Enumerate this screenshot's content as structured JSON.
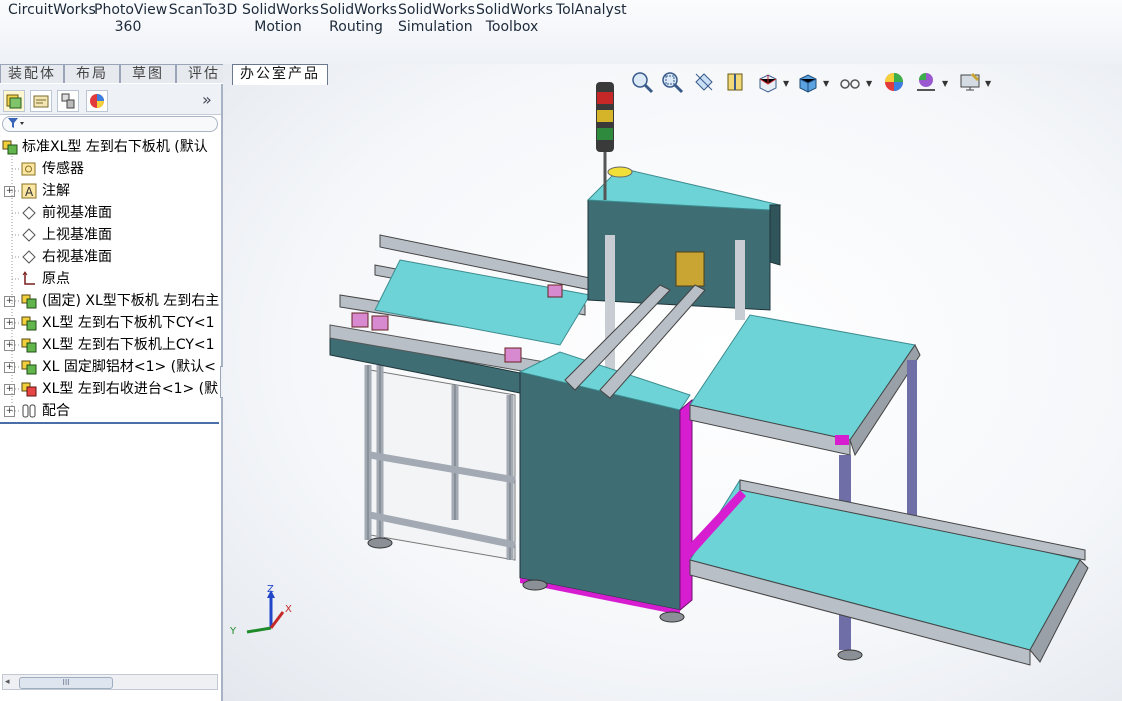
{
  "ribbon": {
    "commands": [
      {
        "label": "CircuitWorks"
      },
      {
        "label": "PhotoView\n360"
      },
      {
        "label": "ScanTo3D"
      },
      {
        "label": "SolidWorks\nMotion"
      },
      {
        "label": "SolidWorks\nRouting"
      },
      {
        "label": "SolidWorks\nSimulation"
      },
      {
        "label": "SolidWorks\nToolbox"
      },
      {
        "label": "TolAnalyst"
      }
    ]
  },
  "tabs": [
    {
      "label": "装配体"
    },
    {
      "label": "布局"
    },
    {
      "label": "草图"
    },
    {
      "label": "评估"
    },
    {
      "label": "办公室产品"
    }
  ],
  "panel": {
    "more_glyph": "»",
    "tree": [
      {
        "label": "标准XL型 左到右下板机 (默认"
      },
      {
        "label": "传感器"
      },
      {
        "label": "注解"
      },
      {
        "label": "前视基准面"
      },
      {
        "label": "上视基准面"
      },
      {
        "label": "右视基准面"
      },
      {
        "label": "原点"
      },
      {
        "label": "(固定) XL型下板机 左到右主"
      },
      {
        "label": "XL型 左到右下板机下CY<1"
      },
      {
        "label": "XL型 左到右下板机上CY<1"
      },
      {
        "label": "XL 固定脚铝材<1> (默认<"
      },
      {
        "label": "XL型 左到右收进台<1> (默"
      },
      {
        "label": "配合"
      }
    ],
    "scroll_grip": "III"
  },
  "viewport": {
    "triad": {
      "x": "X",
      "y": "Y",
      "z": "Z"
    },
    "colors": {
      "panel_cyan": "#6dd3d6",
      "frame_teal": "#3f6d74",
      "rail_gray": "#b9bfc7",
      "accent_magenta": "#d61ed0",
      "leg_blue": "#6f6ea7"
    }
  }
}
